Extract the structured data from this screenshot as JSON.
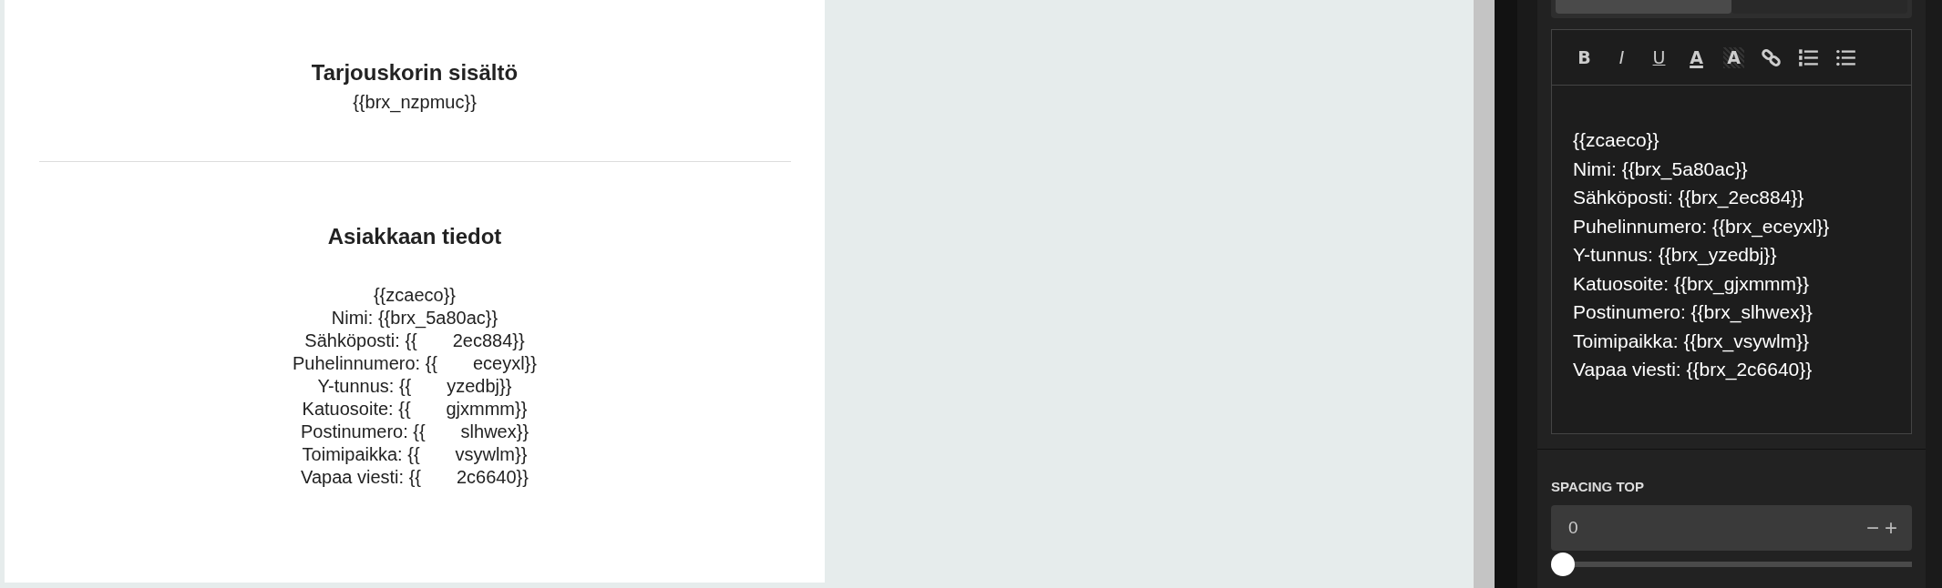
{
  "preview": {
    "sections": [
      {
        "title": "Tarjouskorin sisältö",
        "lines": [
          "{{brx_nzpmuc}}"
        ]
      },
      {
        "title": "Asiakkaan tiedot",
        "lines": [
          "{{zcaeco}}",
          "Nimi: {{brx_5a80ac}}",
          "Sähköposti: {{       2ec884}}",
          "Puhelinnumero: {{       eceyxl}}",
          "Y-tunnus: {{       yzedbj}}",
          "Katuosoite: {{       gjxmmm}}",
          "Postinumero: {{       slhwex}}",
          "Toimipaikka: {{       vsywlm}}",
          "Vapaa viesti: {{       2c6640}}"
        ]
      }
    ]
  },
  "editor": {
    "tabs": [
      {
        "selected": true
      },
      {
        "selected": false
      }
    ],
    "toolbar": [
      {
        "kind": "bold",
        "label": "B"
      },
      {
        "kind": "italic",
        "label": "I"
      },
      {
        "kind": "underline",
        "label": "U"
      },
      {
        "kind": "color",
        "label": "A"
      },
      {
        "kind": "highlight",
        "label": "A"
      },
      {
        "kind": "link"
      },
      {
        "kind": "ordered-list"
      },
      {
        "kind": "bullet-list"
      }
    ],
    "lines": [
      "{{zcaeco}}",
      "Nimi: {{brx_5a80ac}}",
      "Sähköposti: {{brx_2ec884}}",
      "Puhelinnumero: {{brx_eceyxl}}",
      "Y-tunnus: {{brx_yzedbj}}",
      "Katuosoite: {{brx_gjxmmm}}",
      "Postinumero: {{brx_slhwex}}",
      "Toimipaikka: {{brx_vsywlm}}",
      "Vapaa viesti: {{brx_2c6640}}"
    ]
  },
  "spacing_top": {
    "label": "SPACING TOP",
    "value": "0",
    "minus": "−",
    "plus": "+",
    "level": 0
  }
}
